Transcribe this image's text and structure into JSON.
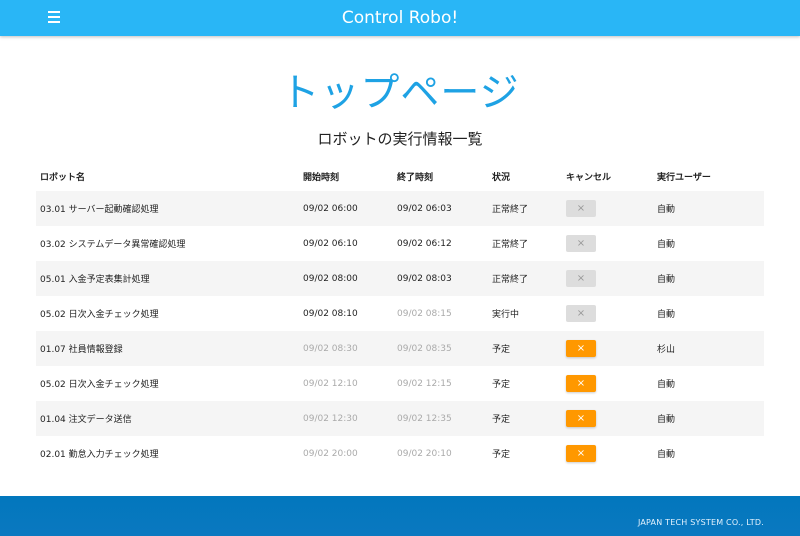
{
  "header": {
    "title": "Control Robo!",
    "menu_icon": "hamburger-menu-icon"
  },
  "page_title": "トップページ",
  "section_title": "ロボットの実行情報一覧",
  "table": {
    "columns": [
      "ロボット名",
      "開始時刻",
      "終了時刻",
      "状況",
      "キャンセル",
      "実行ユーザー"
    ],
    "rows": [
      {
        "name": "03.01 サーバー起動確認処理",
        "start": "09/02 06:00",
        "end": "09/02 06:03",
        "status": "正常終了",
        "cancel": "×",
        "cancel_enabled": false,
        "start_muted": false,
        "end_muted": false,
        "user": "自動"
      },
      {
        "name": "03.02 システムデータ異常確認処理",
        "start": "09/02 06:10",
        "end": "09/02 06:12",
        "status": "正常終了",
        "cancel": "×",
        "cancel_enabled": false,
        "start_muted": false,
        "end_muted": false,
        "user": "自動"
      },
      {
        "name": "05.01 入金予定表集計処理",
        "start": "09/02 08:00",
        "end": "09/02 08:03",
        "status": "正常終了",
        "cancel": "×",
        "cancel_enabled": false,
        "start_muted": false,
        "end_muted": false,
        "user": "自動"
      },
      {
        "name": "05.02 日次入金チェック処理",
        "start": "09/02 08:10",
        "end": "09/02 08:15",
        "status": "実行中",
        "cancel": "×",
        "cancel_enabled": false,
        "start_muted": false,
        "end_muted": true,
        "user": "自動"
      },
      {
        "name": "01.07 社員情報登録",
        "start": "09/02 08:30",
        "end": "09/02 08:35",
        "status": "予定",
        "cancel": "×",
        "cancel_enabled": true,
        "start_muted": true,
        "end_muted": true,
        "user": "杉山"
      },
      {
        "name": "05.02 日次入金チェック処理",
        "start": "09/02 12:10",
        "end": "09/02 12:15",
        "status": "予定",
        "cancel": "×",
        "cancel_enabled": true,
        "start_muted": true,
        "end_muted": true,
        "user": "自動"
      },
      {
        "name": "01.04 注文データ送信",
        "start": "09/02 12:30",
        "end": "09/02 12:35",
        "status": "予定",
        "cancel": "×",
        "cancel_enabled": true,
        "start_muted": true,
        "end_muted": true,
        "user": "自動"
      },
      {
        "name": "02.01 勤怠入力チェック処理",
        "start": "09/02 20:00",
        "end": "09/02 20:10",
        "status": "予定",
        "cancel": "×",
        "cancel_enabled": true,
        "start_muted": true,
        "end_muted": true,
        "user": "自動"
      }
    ]
  },
  "footer": {
    "text": "JAPAN TECH SYSTEM CO., LTD."
  },
  "colors": {
    "header": "#29b6f6",
    "title": "#1ea2e4",
    "cancel_active": "#ff9800",
    "cancel_disabled": "#dddddd",
    "footer": "#0277bd"
  }
}
